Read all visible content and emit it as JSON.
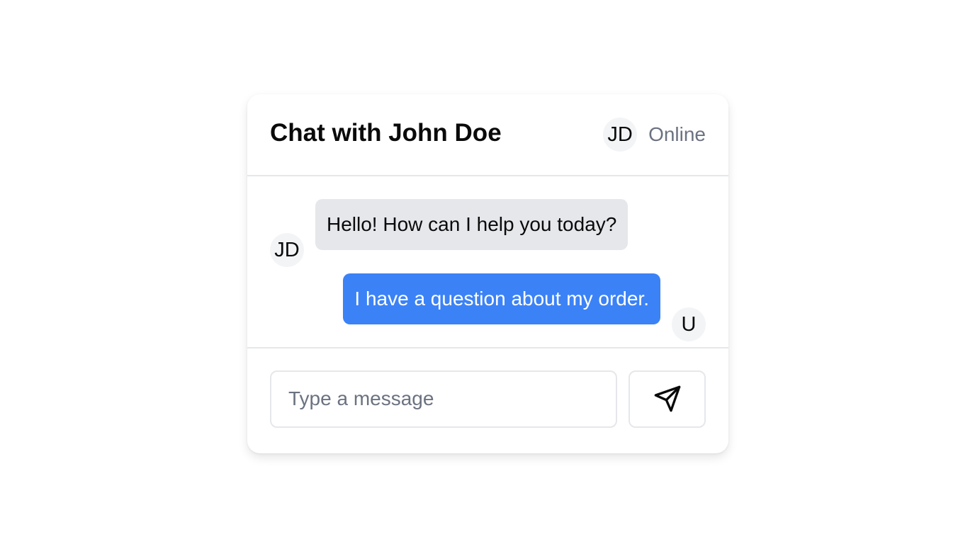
{
  "header": {
    "title": "Chat with John Doe",
    "contact_avatar": "JD",
    "status": "Online"
  },
  "messages": [
    {
      "sender": "contact",
      "avatar": "JD",
      "text": "Hello! How can I help you today?"
    },
    {
      "sender": "user",
      "avatar": "U",
      "text": "I have a question about my order."
    }
  ],
  "composer": {
    "placeholder": "Type a message",
    "value": "",
    "send_icon": "send-icon"
  },
  "colors": {
    "outgoing_bubble": "#3b82f6",
    "incoming_bubble": "#e5e7eb",
    "status_text": "#6b7280",
    "border": "#e5e7eb"
  }
}
